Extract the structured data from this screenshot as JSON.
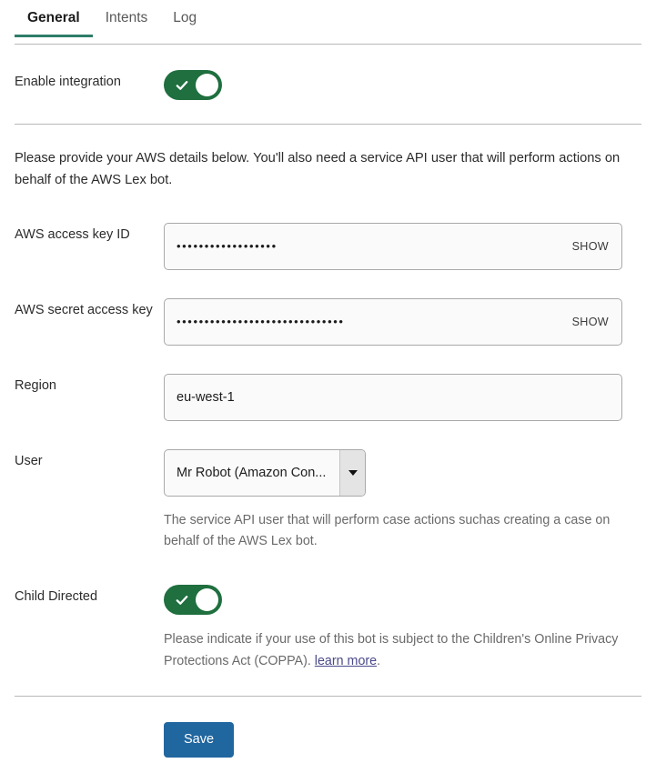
{
  "tabs": [
    {
      "label": "General",
      "active": true
    },
    {
      "label": "Intents",
      "active": false
    },
    {
      "label": "Log",
      "active": false
    }
  ],
  "enable_integration": {
    "label": "Enable integration",
    "state": "on"
  },
  "intro": "Please provide your AWS details below. You'll also need a service API user that will perform actions on behalf of the AWS Lex bot.",
  "access_key": {
    "label": "AWS access key ID",
    "value": "••••••••••••••••••",
    "show_label": "SHOW"
  },
  "secret_key": {
    "label": "AWS secret access key",
    "value": "••••••••••••••••••••••••••••••",
    "show_label": "SHOW"
  },
  "region": {
    "label": "Region",
    "value": "eu-west-1",
    "placeholder": "Region"
  },
  "user": {
    "label": "User",
    "value": "Mr Robot (Amazon Con...",
    "help": "The service API user that will perform case actions suchas creating a case on behalf of the AWS Lex bot."
  },
  "child_directed": {
    "label": "Child Directed",
    "state": "on",
    "help_before": "Please indicate if your use of this bot is subject to the Children's Online Privacy Protections Act (COPPA). ",
    "help_link": "learn more",
    "help_after": "."
  },
  "save": {
    "label": "Save"
  },
  "colors": {
    "tab_underline": "#2e7d69",
    "toggle_on": "#1f6f3f",
    "save_button": "#20669f",
    "link": "#4a4a8a",
    "divider": "#b8b8b8"
  }
}
